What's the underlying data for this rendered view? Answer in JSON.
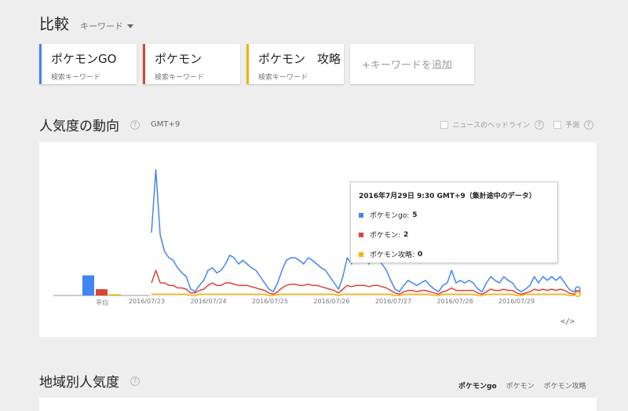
{
  "header": {
    "title": "比較",
    "keyword_dropdown": "キーワード"
  },
  "cards": [
    {
      "keyword": "ポケモンGO",
      "sub": "検索キーワード",
      "color": "#4285f4"
    },
    {
      "keyword": "ポケモン",
      "sub": "検索キーワード",
      "color": "#db4437"
    },
    {
      "keyword": "ポケモン　攻略",
      "sub": "検索キーワード",
      "color": "#f4b400"
    }
  ],
  "add_keyword": "+キーワードを追加",
  "trend": {
    "title": "人気度の動向",
    "help": "?",
    "timezone": "GMT+9",
    "headlines_label": "ニュースのヘッドライン",
    "forecast_label": "予測"
  },
  "tooltip": {
    "title": "2016年7月29日 9:30 GMT+9（集計途中のデータ）",
    "rows": [
      {
        "label": "ポケモンgo:",
        "value": "5",
        "color": "#4285f4"
      },
      {
        "label": "ポケモン:",
        "value": "2",
        "color": "#db4437"
      },
      {
        "label": "ポケモン攻略:",
        "value": "0",
        "color": "#f4b400"
      }
    ]
  },
  "embed_label": "</>",
  "region": {
    "title": "地域別人気度",
    "help": "?",
    "tabs": [
      "ポケモンgo",
      "ポケモン",
      "ポケモン攻略"
    ]
  },
  "chart_data": {
    "type": "line",
    "average_label": "平均",
    "averages": [
      {
        "name": "ポケモンGO",
        "value": 16,
        "color": "#4285f4"
      },
      {
        "name": "ポケモン",
        "value": 5,
        "color": "#db4437"
      },
      {
        "name": "ポケモン　攻略",
        "value": 1,
        "color": "#f4b400"
      }
    ],
    "x_ticks": [
      "2016/07/23",
      "2016/07/24",
      "2016/07/25",
      "2016/07/26",
      "2016/07/27",
      "2016/07/28",
      "2016/07/29"
    ],
    "ylim": [
      0,
      100
    ],
    "series": [
      {
        "name": "ポケモンGO",
        "color": "#4285f4",
        "values": [
          50,
          100,
          48,
          35,
          30,
          28,
          22,
          18,
          15,
          5,
          3,
          8,
          12,
          20,
          22,
          18,
          20,
          25,
          32,
          30,
          25,
          28,
          25,
          22,
          20,
          15,
          10,
          5,
          3,
          10,
          20,
          28,
          30,
          30,
          28,
          25,
          30,
          28,
          25,
          22,
          20,
          15,
          10,
          5,
          15,
          30,
          25,
          35,
          28,
          30,
          25,
          30,
          28,
          25,
          20,
          12,
          5,
          3,
          8,
          12,
          10,
          8,
          10,
          12,
          8,
          5,
          3,
          8,
          10,
          20,
          10,
          12,
          10,
          12,
          10,
          5,
          3,
          10,
          15,
          12,
          10,
          15,
          12,
          10,
          5,
          3,
          5,
          8,
          15,
          10,
          15,
          12,
          15,
          12,
          15,
          10,
          5,
          3,
          5
        ]
      },
      {
        "name": "ポケモン",
        "color": "#db4437",
        "values": [
          10,
          20,
          10,
          10,
          8,
          8,
          6,
          6,
          5,
          2,
          2,
          4,
          5,
          8,
          10,
          8,
          8,
          10,
          10,
          9,
          8,
          8,
          8,
          7,
          6,
          5,
          4,
          2,
          1,
          3,
          6,
          8,
          9,
          9,
          8,
          8,
          9,
          8,
          8,
          7,
          6,
          5,
          4,
          2,
          5,
          8,
          7,
          8,
          8,
          8,
          7,
          8,
          8,
          7,
          6,
          4,
          2,
          1,
          3,
          4,
          4,
          3,
          4,
          4,
          3,
          2,
          1,
          3,
          4,
          6,
          4,
          4,
          4,
          4,
          4,
          2,
          1,
          3,
          5,
          4,
          4,
          5,
          4,
          4,
          2,
          1,
          2,
          3,
          5,
          4,
          5,
          4,
          5,
          4,
          5,
          4,
          2,
          1,
          2
        ]
      },
      {
        "name": "ポケモン　攻略",
        "color": "#f4b400",
        "values": [
          1,
          1,
          1,
          1,
          1,
          1,
          1,
          1,
          1,
          0,
          0,
          1,
          1,
          1,
          1,
          1,
          1,
          1,
          1,
          1,
          1,
          1,
          1,
          1,
          1,
          1,
          1,
          0,
          0,
          1,
          1,
          1,
          1,
          1,
          1,
          1,
          1,
          1,
          1,
          1,
          1,
          1,
          1,
          0,
          1,
          1,
          1,
          1,
          1,
          1,
          1,
          1,
          1,
          1,
          1,
          1,
          0,
          0,
          1,
          1,
          1,
          1,
          1,
          1,
          1,
          0,
          0,
          1,
          1,
          1,
          1,
          1,
          1,
          1,
          1,
          0,
          0,
          1,
          1,
          1,
          1,
          1,
          1,
          1,
          0,
          0,
          1,
          1,
          1,
          1,
          1,
          1,
          1,
          1,
          1,
          1,
          0,
          0,
          1
        ]
      }
    ]
  }
}
